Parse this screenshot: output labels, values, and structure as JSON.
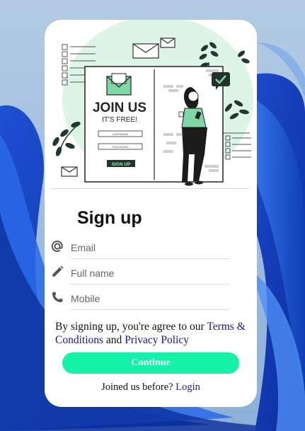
{
  "colors": {
    "accent": "#13f2a6",
    "illustration_green": "#7fd7a4",
    "link": "#1a0dab",
    "desktop_blue": "#1a5fd9"
  },
  "illustration": {
    "headline": "JOIN US",
    "subline": "IT'S FREE!",
    "username_label": "USERNAME",
    "password_label": "PASSWORD",
    "button_label": "SIGN UP"
  },
  "form": {
    "title": "Sign up",
    "email_placeholder": "Email",
    "fullname_placeholder": "Full name",
    "mobile_placeholder": "Mobile",
    "icons": [
      "at-icon",
      "pencil-icon",
      "phone-icon"
    ]
  },
  "terms": {
    "prefix": "By signing up, you're agree to our ",
    "terms_link": "Terms & Conditions",
    "middle": " and ",
    "privacy_link": "Privacy Policy"
  },
  "continue_label": "Continue",
  "footer": {
    "prompt": "Joined us before? ",
    "login_link": "Login"
  }
}
